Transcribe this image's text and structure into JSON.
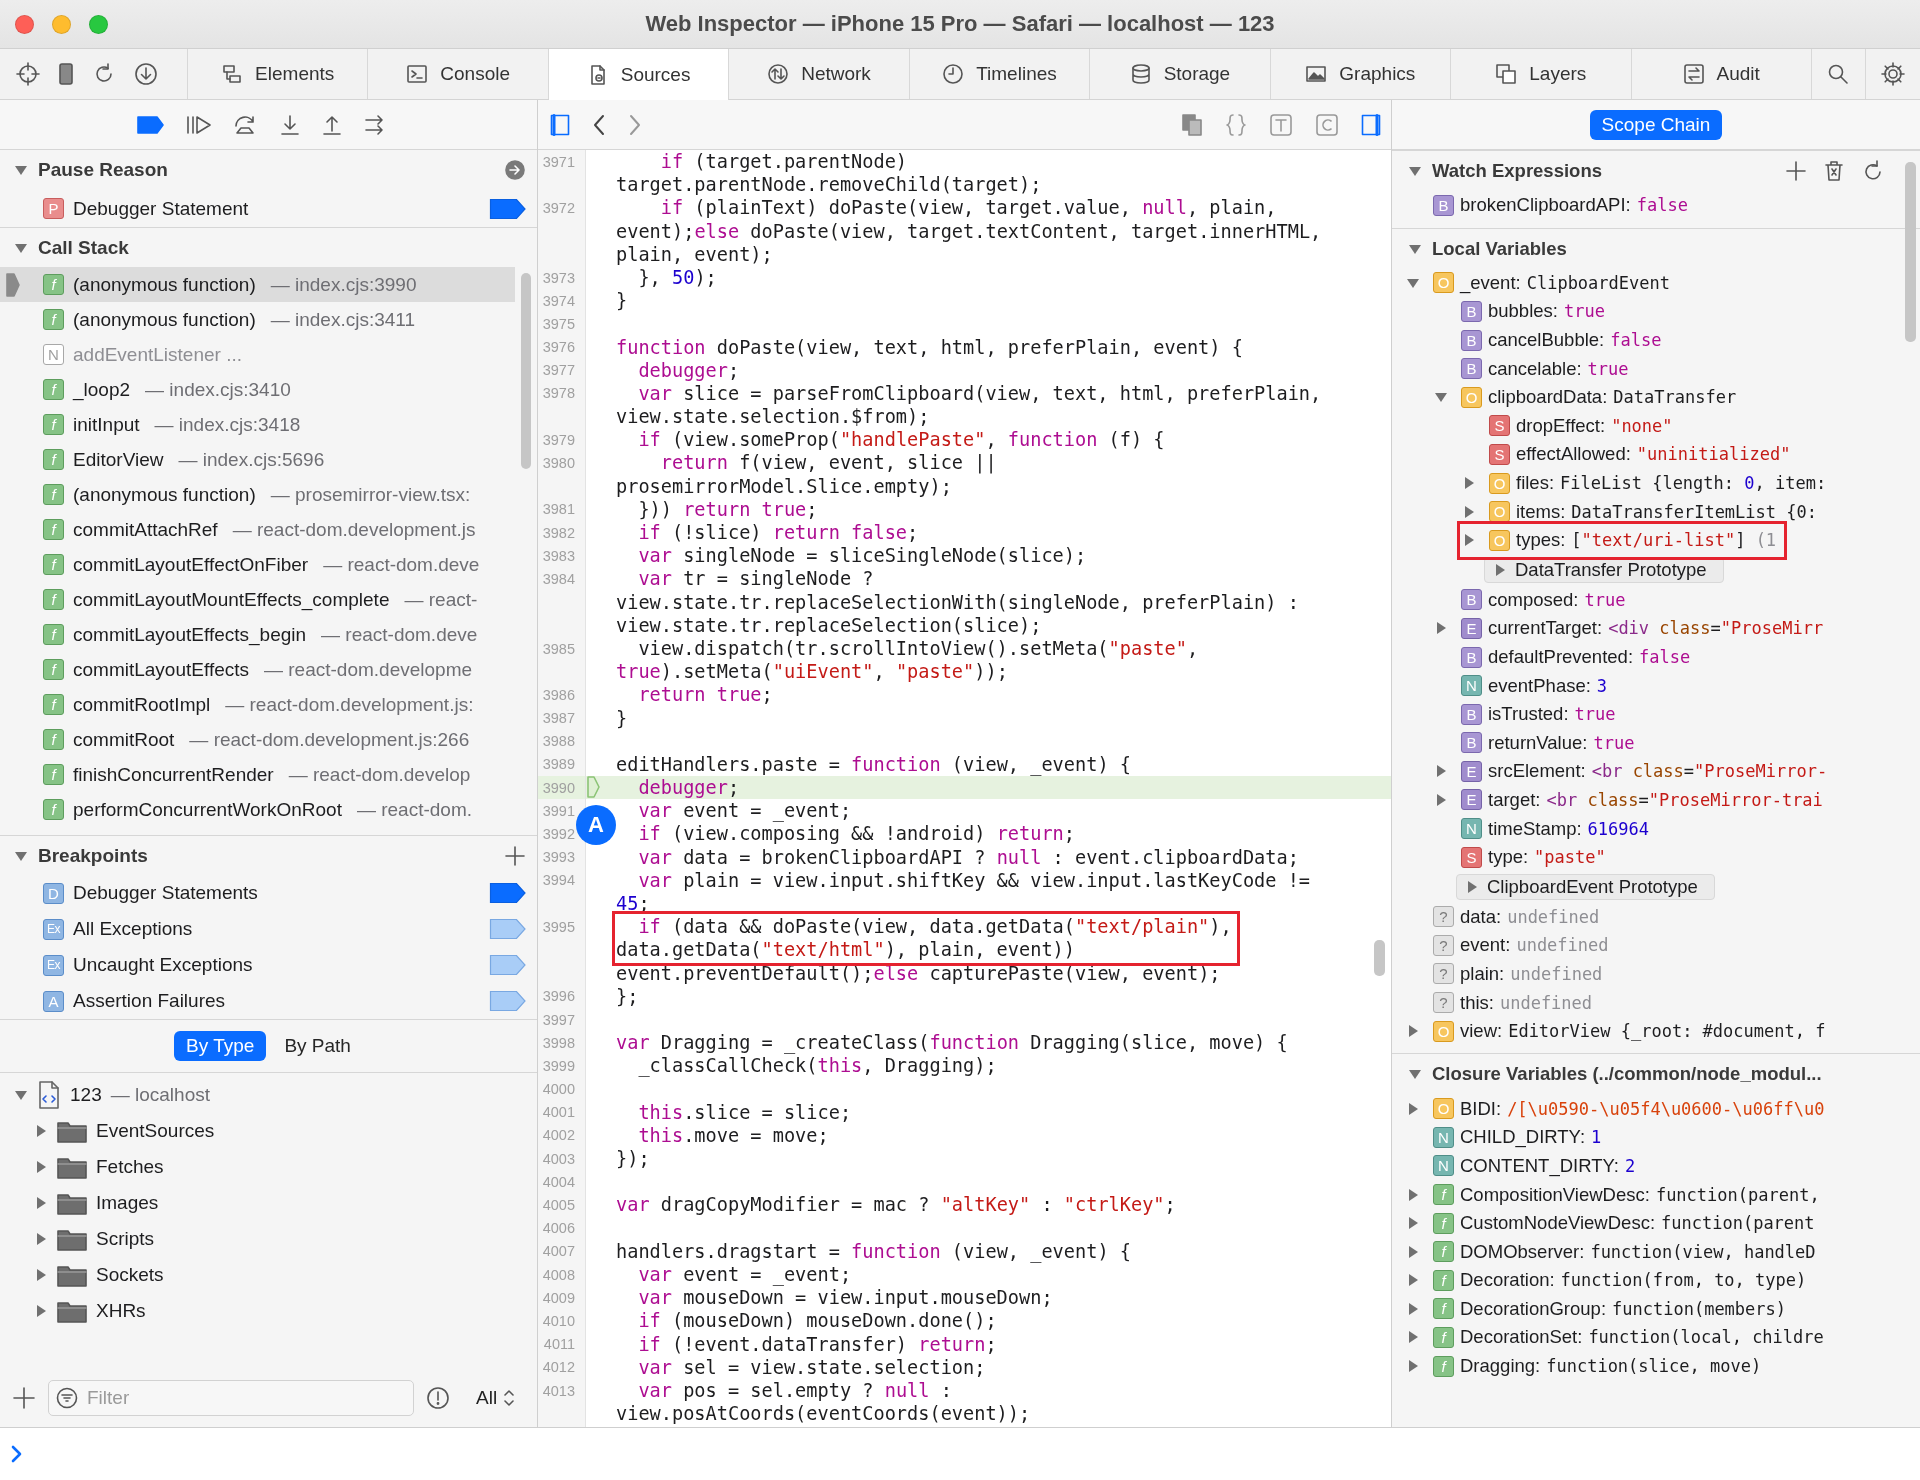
{
  "window": {
    "title": "Web Inspector — iPhone 15 Pro — Safari — localhost — 123"
  },
  "tabs": [
    {
      "label": "Elements",
      "selected": false
    },
    {
      "label": "Console",
      "selected": false
    },
    {
      "label": "Sources",
      "selected": true
    },
    {
      "label": "Network",
      "selected": false
    },
    {
      "label": "Timelines",
      "selected": false
    },
    {
      "label": "Storage",
      "selected": false
    },
    {
      "label": "Graphics",
      "selected": false
    },
    {
      "label": "Layers",
      "selected": false
    },
    {
      "label": "Audit",
      "selected": false
    }
  ],
  "left_sidebar": {
    "pause_reason": {
      "title": "Pause Reason",
      "expanded": true,
      "item": {
        "badge": "P",
        "kind": "pause",
        "label": "Debugger Statement"
      }
    },
    "call_stack": {
      "title": "Call Stack",
      "expanded": true,
      "items": [
        {
          "badge": "f",
          "kind": "function",
          "name": "(anonymous function)",
          "location": "— index.cjs:3990",
          "selected": true
        },
        {
          "badge": "f",
          "kind": "function",
          "name": "(anonymous function)",
          "location": "— index.cjs:3411",
          "selected": false
        },
        {
          "badge": "N",
          "kind": "native",
          "name": "addEventListener ...",
          "selected": false
        },
        {
          "badge": "f",
          "kind": "function",
          "name": "_loop2",
          "location": "— index.cjs:3410",
          "selected": false
        },
        {
          "badge": "f",
          "kind": "function",
          "name": "initInput",
          "location": "— index.cjs:3418",
          "selected": false
        },
        {
          "badge": "f",
          "kind": "function",
          "name": "EditorView",
          "location": "— index.cjs:5696",
          "selected": false
        },
        {
          "badge": "f",
          "kind": "function",
          "name": "(anonymous function)",
          "location": "— prosemirror-view.tsx:",
          "selected": false
        },
        {
          "badge": "f",
          "kind": "function",
          "name": "commitAttachRef",
          "location": "— react-dom.development.js",
          "selected": false
        },
        {
          "badge": "f",
          "kind": "function",
          "name": "commitLayoutEffectOnFiber",
          "location": "— react-dom.deve",
          "selected": false
        },
        {
          "badge": "f",
          "kind": "function",
          "name": "commitLayoutMountEffects_complete",
          "location": "— react-",
          "selected": false
        },
        {
          "badge": "f",
          "kind": "function",
          "name": "commitLayoutEffects_begin",
          "location": "— react-dom.deve",
          "selected": false
        },
        {
          "badge": "f",
          "kind": "function",
          "name": "commitLayoutEffects",
          "location": "— react-dom.developme",
          "selected": false
        },
        {
          "badge": "f",
          "kind": "function",
          "name": "commitRootImpl",
          "location": "— react-dom.development.js:",
          "selected": false
        },
        {
          "badge": "f",
          "kind": "function",
          "name": "commitRoot",
          "location": "— react-dom.development.js:266",
          "selected": false
        },
        {
          "badge": "f",
          "kind": "function",
          "name": "finishConcurrentRender",
          "location": "— react-dom.develop",
          "selected": false
        },
        {
          "badge": "f",
          "kind": "function",
          "name": "performConcurrentWorkOnRoot",
          "location": "— react-dom.",
          "selected": false
        }
      ]
    },
    "breakpoints": {
      "title": "Breakpoints",
      "expanded": true,
      "items": [
        {
          "badge": "D",
          "label": "Debugger Statements",
          "enabled": true
        },
        {
          "badge": "Ex",
          "label": "All Exceptions",
          "enabled": false
        },
        {
          "badge": "Ex",
          "label": "Uncaught Exceptions",
          "enabled": false
        },
        {
          "badge": "A",
          "label": "Assertion Failures",
          "enabled": false
        }
      ]
    },
    "grouping": [
      {
        "label": "By Type",
        "selected": true
      },
      {
        "label": "By Path",
        "selected": false
      }
    ],
    "resources": {
      "name": "123",
      "host": "— localhost",
      "expanded": true,
      "children": [
        {
          "name": "EventSources",
          "expanded": false
        },
        {
          "name": "Fetches",
          "expanded": false
        },
        {
          "name": "Images",
          "expanded": false
        },
        {
          "name": "Scripts",
          "expanded": false
        },
        {
          "name": "Sockets",
          "expanded": false
        },
        {
          "name": "XHRs",
          "expanded": false
        }
      ]
    },
    "filter": {
      "placeholder": "Filter",
      "scope": "All"
    }
  },
  "editor": {
    "rows": [
      {
        "number": "3971",
        "paused": false,
        "annotated": false,
        "tokens": [
          {
            "kind": "keyword",
            "text": "    if"
          },
          {
            "kind": "plain",
            "text": " (target.parentNode)"
          }
        ]
      },
      {
        "paused": false,
        "annotated": false,
        "tokens": [
          {
            "kind": "plain",
            "text": "target.parentNode.removeChild(target);"
          }
        ]
      },
      {
        "number": "3972",
        "paused": false,
        "annotated": false,
        "tokens": [
          {
            "kind": "keyword",
            "text": "    if"
          },
          {
            "kind": "plain",
            "text": " (plainText) doPaste(view, target.value, "
          },
          {
            "kind": "keyword",
            "text": "null"
          },
          {
            "kind": "plain",
            "text": ", plain,"
          }
        ]
      },
      {
        "paused": false,
        "annotated": false,
        "tokens": [
          {
            "kind": "plain",
            "text": "event);"
          },
          {
            "kind": "keyword",
            "text": "else"
          },
          {
            "kind": "plain",
            "text": " doPaste(view, target.textContent, target.innerHTML,"
          }
        ]
      },
      {
        "paused": false,
        "annotated": false,
        "tokens": [
          {
            "kind": "plain",
            "text": "plain, event);"
          }
        ]
      },
      {
        "number": "3973",
        "paused": false,
        "annotated": false,
        "tokens": [
          {
            "kind": "plain",
            "text": "  }, "
          },
          {
            "kind": "number",
            "text": "50"
          },
          {
            "kind": "plain",
            "text": ");"
          }
        ]
      },
      {
        "number": "3974",
        "paused": false,
        "annotated": false,
        "tokens": [
          {
            "kind": "plain",
            "text": "}"
          }
        ]
      },
      {
        "number": "3975",
        "paused": false,
        "annotated": false
      },
      {
        "number": "3976",
        "paused": false,
        "annotated": false,
        "tokens": [
          {
            "kind": "keyword",
            "text": "function"
          },
          {
            "kind": "plain",
            "text": " doPaste(view, text, html, preferPlain, event) {"
          }
        ]
      },
      {
        "number": "3977",
        "paused": false,
        "annotated": false,
        "tokens": [
          {
            "kind": "keyword",
            "text": "  debugger"
          },
          {
            "kind": "plain",
            "text": ";"
          }
        ]
      },
      {
        "number": "3978",
        "paused": false,
        "annotated": false,
        "tokens": [
          {
            "kind": "keyword",
            "text": "  var"
          },
          {
            "kind": "plain",
            "text": " slice = parseFromClipboard(view, text, html, preferPlain,"
          }
        ]
      },
      {
        "paused": false,
        "annotated": false,
        "tokens": [
          {
            "kind": "plain",
            "text": "view.state.selection.$from);"
          }
        ]
      },
      {
        "number": "3979",
        "paused": false,
        "annotated": false,
        "tokens": [
          {
            "kind": "keyword",
            "text": "  if"
          },
          {
            "kind": "plain",
            "text": " (view.someProp("
          },
          {
            "kind": "string",
            "text": "\"handlePaste\""
          },
          {
            "kind": "plain",
            "text": ", "
          },
          {
            "kind": "keyword",
            "text": "function"
          },
          {
            "kind": "plain",
            "text": " (f) {"
          }
        ]
      },
      {
        "number": "3980",
        "paused": false,
        "annotated": false,
        "tokens": [
          {
            "kind": "keyword",
            "text": "    return"
          },
          {
            "kind": "plain",
            "text": " f(view, event, slice ||"
          }
        ]
      },
      {
        "paused": false,
        "annotated": false,
        "tokens": [
          {
            "kind": "plain",
            "text": "prosemirrorModel.Slice.empty);"
          }
        ]
      },
      {
        "number": "3981",
        "paused": false,
        "annotated": false,
        "tokens": [
          {
            "kind": "plain",
            "text": "  })) "
          },
          {
            "kind": "keyword",
            "text": "return true"
          },
          {
            "kind": "plain",
            "text": ";"
          }
        ]
      },
      {
        "number": "3982",
        "paused": false,
        "annotated": false,
        "tokens": [
          {
            "kind": "keyword",
            "text": "  if"
          },
          {
            "kind": "plain",
            "text": " (!slice) "
          },
          {
            "kind": "keyword",
            "text": "return false"
          },
          {
            "kind": "plain",
            "text": ";"
          }
        ]
      },
      {
        "number": "3983",
        "paused": false,
        "annotated": false,
        "tokens": [
          {
            "kind": "keyword",
            "text": "  var"
          },
          {
            "kind": "plain",
            "text": " singleNode = sliceSingleNode(slice);"
          }
        ]
      },
      {
        "number": "3984",
        "paused": false,
        "annotated": false,
        "tokens": [
          {
            "kind": "keyword",
            "text": "  var"
          },
          {
            "kind": "plain",
            "text": " tr = singleNode ?"
          }
        ]
      },
      {
        "paused": false,
        "annotated": false,
        "tokens": [
          {
            "kind": "plain",
            "text": "view.state.tr.replaceSelectionWith(singleNode, preferPlain) :"
          }
        ]
      },
      {
        "paused": false,
        "annotated": false,
        "tokens": [
          {
            "kind": "plain",
            "text": "view.state.tr.replaceSelection(slice);"
          }
        ]
      },
      {
        "number": "3985",
        "paused": false,
        "annotated": false,
        "tokens": [
          {
            "kind": "plain",
            "text": "  view.dispatch(tr.scrollIntoView().setMeta("
          },
          {
            "kind": "string",
            "text": "\"paste\""
          },
          {
            "kind": "plain",
            "text": ","
          }
        ]
      },
      {
        "paused": false,
        "annotated": false,
        "tokens": [
          {
            "kind": "keyword",
            "text": "true"
          },
          {
            "kind": "plain",
            "text": ").setMeta("
          },
          {
            "kind": "string",
            "text": "\"uiEvent\""
          },
          {
            "kind": "plain",
            "text": ", "
          },
          {
            "kind": "string",
            "text": "\"paste\""
          },
          {
            "kind": "plain",
            "text": "));"
          }
        ]
      },
      {
        "number": "3986",
        "paused": false,
        "annotated": false,
        "tokens": [
          {
            "kind": "keyword",
            "text": "  return true"
          },
          {
            "kind": "plain",
            "text": ";"
          }
        ]
      },
      {
        "number": "3987",
        "paused": false,
        "annotated": false,
        "tokens": [
          {
            "kind": "plain",
            "text": "}"
          }
        ]
      },
      {
        "number": "3988",
        "paused": false,
        "annotated": false
      },
      {
        "number": "3989",
        "paused": false,
        "annotated": false,
        "tokens": [
          {
            "kind": "plain",
            "text": "editHandlers.paste = "
          },
          {
            "kind": "keyword",
            "text": "function"
          },
          {
            "kind": "plain",
            "text": " (view, _event) {"
          }
        ]
      },
      {
        "number": "3990",
        "paused": true,
        "annotated": false,
        "tokens": [
          {
            "kind": "keyword",
            "text": "  debugger"
          },
          {
            "kind": "plain",
            "text": ";"
          }
        ]
      },
      {
        "number": "3991",
        "marker": "A",
        "paused": false,
        "annotated": false,
        "tokens": [
          {
            "kind": "keyword",
            "text": "  var"
          },
          {
            "kind": "plain",
            "text": " event = _event;"
          }
        ]
      },
      {
        "number": "3992",
        "paused": false,
        "annotated": false,
        "tokens": [
          {
            "kind": "keyword",
            "text": "  if"
          },
          {
            "kind": "plain",
            "text": " (view.composing && !android) "
          },
          {
            "kind": "keyword",
            "text": "return"
          },
          {
            "kind": "plain",
            "text": ";"
          }
        ]
      },
      {
        "number": "3993",
        "paused": false,
        "annotated": false,
        "tokens": [
          {
            "kind": "keyword",
            "text": "  var"
          },
          {
            "kind": "plain",
            "text": " data = brokenClipboardAPI ? "
          },
          {
            "kind": "keyword",
            "text": "null"
          },
          {
            "kind": "plain",
            "text": " : event.clipboardData;"
          }
        ]
      },
      {
        "number": "3994",
        "paused": false,
        "annotated": false,
        "tokens": [
          {
            "kind": "keyword",
            "text": "  var"
          },
          {
            "kind": "plain",
            "text": " plain = view.input.shiftKey && view.input.lastKeyCode !="
          }
        ]
      },
      {
        "paused": false,
        "annotated": false,
        "tokens": [
          {
            "kind": "number",
            "text": "45"
          },
          {
            "kind": "plain",
            "text": ";"
          }
        ]
      },
      {
        "number": "3995",
        "paused": false,
        "annotated": true,
        "tokens": [
          {
            "kind": "keyword",
            "text": "  if"
          },
          {
            "kind": "plain",
            "text": " (data && doPaste(view, data.getData("
          },
          {
            "kind": "string",
            "text": "\"text/plain\""
          },
          {
            "kind": "plain",
            "text": "),"
          }
        ]
      },
      {
        "paused": false,
        "annotated": true,
        "tokens": [
          {
            "kind": "plain",
            "text": "data.getData("
          },
          {
            "kind": "string",
            "text": "\"text/html\""
          },
          {
            "kind": "plain",
            "text": "), plain, event))"
          }
        ]
      },
      {
        "paused": false,
        "annotated": false,
        "tokens": [
          {
            "kind": "plain",
            "text": "event.preventDefault();"
          },
          {
            "kind": "keyword",
            "text": "else"
          },
          {
            "kind": "plain",
            "text": " capturePaste(view, event);"
          }
        ]
      },
      {
        "number": "3996",
        "paused": false,
        "annotated": false,
        "tokens": [
          {
            "kind": "plain",
            "text": "};"
          }
        ]
      },
      {
        "number": "3997",
        "paused": false,
        "annotated": false
      },
      {
        "number": "3998",
        "paused": false,
        "annotated": false,
        "tokens": [
          {
            "kind": "keyword",
            "text": "var"
          },
          {
            "kind": "plain",
            "text": " Dragging = _createClass("
          },
          {
            "kind": "keyword",
            "text": "function"
          },
          {
            "kind": "plain",
            "text": " Dragging(slice, move) {"
          }
        ]
      },
      {
        "number": "3999",
        "paused": false,
        "annotated": false,
        "tokens": [
          {
            "kind": "plain",
            "text": "  _classCallCheck("
          },
          {
            "kind": "keyword",
            "text": "this"
          },
          {
            "kind": "plain",
            "text": ", Dragging);"
          }
        ]
      },
      {
        "number": "4000",
        "paused": false,
        "annotated": false
      },
      {
        "number": "4001",
        "paused": false,
        "annotated": false,
        "tokens": [
          {
            "kind": "keyword",
            "text": "  this"
          },
          {
            "kind": "plain",
            "text": ".slice = slice;"
          }
        ]
      },
      {
        "number": "4002",
        "paused": false,
        "annotated": false,
        "tokens": [
          {
            "kind": "keyword",
            "text": "  this"
          },
          {
            "kind": "plain",
            "text": ".move = move;"
          }
        ]
      },
      {
        "number": "4003",
        "paused": false,
        "annotated": false,
        "tokens": [
          {
            "kind": "plain",
            "text": "});"
          }
        ]
      },
      {
        "number": "4004",
        "paused": false,
        "annotated": false
      },
      {
        "number": "4005",
        "paused": false,
        "annotated": false,
        "tokens": [
          {
            "kind": "keyword",
            "text": "var"
          },
          {
            "kind": "plain",
            "text": " dragCopyModifier = mac ? "
          },
          {
            "kind": "string",
            "text": "\"altKey\""
          },
          {
            "kind": "plain",
            "text": " : "
          },
          {
            "kind": "string",
            "text": "\"ctrlKey\""
          },
          {
            "kind": "plain",
            "text": ";"
          }
        ]
      },
      {
        "number": "4006",
        "paused": false,
        "annotated": false
      },
      {
        "number": "4007",
        "paused": false,
        "annotated": false,
        "tokens": [
          {
            "kind": "plain",
            "text": "handlers.dragstart = "
          },
          {
            "kind": "keyword",
            "text": "function"
          },
          {
            "kind": "plain",
            "text": " (view, _event) {"
          }
        ]
      },
      {
        "number": "4008",
        "paused": false,
        "annotated": false,
        "tokens": [
          {
            "kind": "keyword",
            "text": "  var"
          },
          {
            "kind": "plain",
            "text": " event = _event;"
          }
        ]
      },
      {
        "number": "4009",
        "paused": false,
        "annotated": false,
        "tokens": [
          {
            "kind": "keyword",
            "text": "  var"
          },
          {
            "kind": "plain",
            "text": " mouseDown = view.input.mouseDown;"
          }
        ]
      },
      {
        "number": "4010",
        "paused": false,
        "annotated": false,
        "tokens": [
          {
            "kind": "keyword",
            "text": "  if"
          },
          {
            "kind": "plain",
            "text": " (mouseDown) mouseDown.done();"
          }
        ]
      },
      {
        "number": "4011",
        "paused": false,
        "annotated": false,
        "tokens": [
          {
            "kind": "keyword",
            "text": "  if"
          },
          {
            "kind": "plain",
            "text": " (!event.dataTransfer) "
          },
          {
            "kind": "keyword",
            "text": "return"
          },
          {
            "kind": "plain",
            "text": ";"
          }
        ]
      },
      {
        "number": "4012",
        "paused": false,
        "annotated": false,
        "tokens": [
          {
            "kind": "keyword",
            "text": "  var"
          },
          {
            "kind": "plain",
            "text": " sel = view.state.selection;"
          }
        ]
      },
      {
        "number": "4013",
        "paused": false,
        "annotated": false,
        "tokens": [
          {
            "kind": "keyword",
            "text": "  var"
          },
          {
            "kind": "plain",
            "text": " pos = sel.empty ? "
          },
          {
            "kind": "keyword",
            "text": "null"
          },
          {
            "kind": "plain",
            "text": " :"
          }
        ]
      },
      {
        "paused": false,
        "annotated": false,
        "tokens": [
          {
            "kind": "plain",
            "text": "view.posAtCoords(eventCoords(event));"
          }
        ]
      }
    ]
  },
  "details": {
    "scope_button": "Scope Chain",
    "sections": [
      {
        "title": "Watch Expressions",
        "expanded": true,
        "items": [
          {
            "kind": "boolean",
            "badge": "B",
            "name": "brokenClipboardAPI:",
            "annotated": false,
            "value": [
              {
                "kind": "keyword",
                "text": "false"
              }
            ]
          }
        ]
      },
      {
        "title": "Local Variables",
        "expanded": true,
        "items": [
          {
            "kind": "object",
            "badge": "O",
            "name": "_event:",
            "expanded": true,
            "annotated": false,
            "value": [
              {
                "kind": "plain",
                "text": "ClipboardEvent"
              }
            ],
            "children": [
              {
                "kind": "boolean",
                "badge": "B",
                "name": "bubbles:",
                "annotated": false,
                "value": [
                  {
                    "kind": "keyword",
                    "text": "true"
                  }
                ]
              },
              {
                "kind": "boolean",
                "badge": "B",
                "name": "cancelBubble:",
                "annotated": false,
                "value": [
                  {
                    "kind": "keyword",
                    "text": "false"
                  }
                ]
              },
              {
                "kind": "boolean",
                "badge": "B",
                "name": "cancelable:",
                "annotated": false,
                "value": [
                  {
                    "kind": "keyword",
                    "text": "true"
                  }
                ]
              },
              {
                "kind": "object",
                "badge": "O",
                "name": "clipboardData:",
                "expanded": true,
                "annotated": false,
                "value": [
                  {
                    "kind": "plain",
                    "text": "DataTransfer"
                  }
                ],
                "children": [
                  {
                    "kind": "string",
                    "badge": "S",
                    "name": "dropEffect:",
                    "annotated": false,
                    "value": [
                      {
                        "kind": "string",
                        "text": "\"none\""
                      }
                    ]
                  },
                  {
                    "kind": "string",
                    "badge": "S",
                    "name": "effectAllowed:",
                    "annotated": false,
                    "value": [
                      {
                        "kind": "string",
                        "text": "\"uninitialized\""
                      }
                    ]
                  },
                  {
                    "kind": "object",
                    "badge": "O",
                    "name": "files:",
                    "expanded": false,
                    "annotated": false,
                    "value": [
                      {
                        "kind": "plain",
                        "text": "FileList {length: "
                      },
                      {
                        "kind": "number",
                        "text": "0"
                      },
                      {
                        "kind": "plain",
                        "text": ", item:"
                      }
                    ]
                  },
                  {
                    "kind": "object",
                    "badge": "O",
                    "name": "items:",
                    "expanded": false,
                    "annotated": false,
                    "value": [
                      {
                        "kind": "plain",
                        "text": "DataTransferItemList {0:"
                      }
                    ]
                  },
                  {
                    "kind": "object",
                    "badge": "O",
                    "name": "types:",
                    "expanded": false,
                    "annotated": true,
                    "value": [
                      {
                        "kind": "plain",
                        "text": "["
                      },
                      {
                        "kind": "string",
                        "text": "\"text/uri-list\""
                      },
                      {
                        "kind": "plain",
                        "text": "] "
                      },
                      {
                        "kind": "dim",
                        "text": "(1"
                      }
                    ]
                  },
                  {
                    "kind": "prototype",
                    "name": "DataTransfer Prototype",
                    "expanded": false,
                    "annotated": false
                  }
                ]
              },
              {
                "kind": "boolean",
                "badge": "B",
                "name": "composed:",
                "annotated": false,
                "value": [
                  {
                    "kind": "keyword",
                    "text": "true"
                  }
                ]
              },
              {
                "kind": "element",
                "badge": "E",
                "name": "currentTarget:",
                "expanded": false,
                "annotated": false,
                "value": [
                  {
                    "kind": "tag",
                    "text": "<div"
                  },
                  {
                    "kind": "attr",
                    "text": " class"
                  },
                  {
                    "kind": "plain",
                    "text": "="
                  },
                  {
                    "kind": "string",
                    "text": "\"ProseMirr"
                  }
                ]
              },
              {
                "kind": "boolean",
                "badge": "B",
                "name": "defaultPrevented:",
                "annotated": false,
                "value": [
                  {
                    "kind": "keyword",
                    "text": "false"
                  }
                ]
              },
              {
                "kind": "number",
                "badge": "N",
                "name": "eventPhase:",
                "annotated": false,
                "value": [
                  {
                    "kind": "number",
                    "text": "3"
                  }
                ]
              },
              {
                "kind": "boolean",
                "badge": "B",
                "name": "isTrusted:",
                "annotated": false,
                "value": [
                  {
                    "kind": "keyword",
                    "text": "true"
                  }
                ]
              },
              {
                "kind": "boolean",
                "badge": "B",
                "name": "returnValue:",
                "annotated": false,
                "value": [
                  {
                    "kind": "keyword",
                    "text": "true"
                  }
                ]
              },
              {
                "kind": "element",
                "badge": "E",
                "name": "srcElement:",
                "expanded": false,
                "annotated": false,
                "value": [
                  {
                    "kind": "tag",
                    "text": "<br"
                  },
                  {
                    "kind": "attr",
                    "text": " class"
                  },
                  {
                    "kind": "plain",
                    "text": "="
                  },
                  {
                    "kind": "string",
                    "text": "\"ProseMirror-"
                  }
                ]
              },
              {
                "kind": "element",
                "badge": "E",
                "name": "target:",
                "expanded": false,
                "annotated": false,
                "value": [
                  {
                    "kind": "tag",
                    "text": "<br"
                  },
                  {
                    "kind": "attr",
                    "text": " class"
                  },
                  {
                    "kind": "plain",
                    "text": "="
                  },
                  {
                    "kind": "string",
                    "text": "\"ProseMirror-trai"
                  }
                ]
              },
              {
                "kind": "number",
                "badge": "N",
                "name": "timeStamp:",
                "annotated": false,
                "value": [
                  {
                    "kind": "number",
                    "text": "616964"
                  }
                ]
              },
              {
                "kind": "string",
                "badge": "S",
                "name": "type:",
                "annotated": false,
                "value": [
                  {
                    "kind": "string",
                    "text": "\"paste\""
                  }
                ]
              },
              {
                "kind": "prototype",
                "name": "ClipboardEvent Prototype",
                "expanded": false,
                "annotated": false
              }
            ]
          },
          {
            "kind": "undefined",
            "badge": "?",
            "name": "data:",
            "annotated": false,
            "value": [
              {
                "kind": "dim",
                "text": "undefined"
              }
            ]
          },
          {
            "kind": "undefined",
            "badge": "?",
            "name": "event:",
            "annotated": false,
            "value": [
              {
                "kind": "dim",
                "text": "undefined"
              }
            ]
          },
          {
            "kind": "undefined",
            "badge": "?",
            "name": "plain:",
            "annotated": false,
            "value": [
              {
                "kind": "dim",
                "text": "undefined"
              }
            ]
          },
          {
            "kind": "undefined",
            "badge": "?",
            "name": "this:",
            "annotated": false,
            "value": [
              {
                "kind": "dim",
                "text": "undefined"
              }
            ]
          },
          {
            "kind": "object",
            "badge": "O",
            "name": "view:",
            "expanded": false,
            "annotated": false,
            "value": [
              {
                "kind": "plain",
                "text": "EditorView {_root: #document, f"
              }
            ]
          }
        ]
      },
      {
        "title": "Closure Variables (../common/node_modul...",
        "expanded": true,
        "items": [
          {
            "kind": "object",
            "badge": "O",
            "name": "BIDI:",
            "expanded": false,
            "annotated": false,
            "value": [
              {
                "kind": "regexp",
                "text": "/[\\u0590-\\u05f4\\u0600-\\u06ff\\u0"
              }
            ]
          },
          {
            "kind": "number",
            "badge": "N",
            "name": "CHILD_DIRTY:",
            "annotated": false,
            "value": [
              {
                "kind": "number",
                "text": "1"
              }
            ]
          },
          {
            "kind": "number",
            "badge": "N",
            "name": "CONTENT_DIRTY:",
            "annotated": false,
            "value": [
              {
                "kind": "number",
                "text": "2"
              }
            ]
          },
          {
            "kind": "function",
            "badge": "f",
            "name": "CompositionViewDesc:",
            "expanded": false,
            "annotated": false,
            "value": [
              {
                "kind": "plain",
                "text": "function(parent,"
              }
            ]
          },
          {
            "kind": "function",
            "badge": "f",
            "name": "CustomNodeViewDesc:",
            "expanded": false,
            "annotated": false,
            "value": [
              {
                "kind": "plain",
                "text": "function(parent"
              }
            ]
          },
          {
            "kind": "function",
            "badge": "f",
            "name": "DOMObserver:",
            "expanded": false,
            "annotated": false,
            "value": [
              {
                "kind": "plain",
                "text": "function(view, handleD"
              }
            ]
          },
          {
            "kind": "function",
            "badge": "f",
            "name": "Decoration:",
            "expanded": false,
            "annotated": false,
            "value": [
              {
                "kind": "plain",
                "text": "function(from, to, type)"
              }
            ]
          },
          {
            "kind": "function",
            "badge": "f",
            "name": "DecorationGroup:",
            "expanded": false,
            "annotated": false,
            "value": [
              {
                "kind": "plain",
                "text": "function(members)"
              }
            ]
          },
          {
            "kind": "function",
            "badge": "f",
            "name": "DecorationSet:",
            "expanded": false,
            "annotated": false,
            "value": [
              {
                "kind": "plain",
                "text": "function(local, childre"
              }
            ]
          },
          {
            "kind": "function",
            "badge": "f",
            "name": "Dragging:",
            "expanded": false,
            "annotated": false,
            "value": [
              {
                "kind": "plain",
                "text": "function(slice, move)"
              }
            ]
          }
        ]
      }
    ]
  }
}
